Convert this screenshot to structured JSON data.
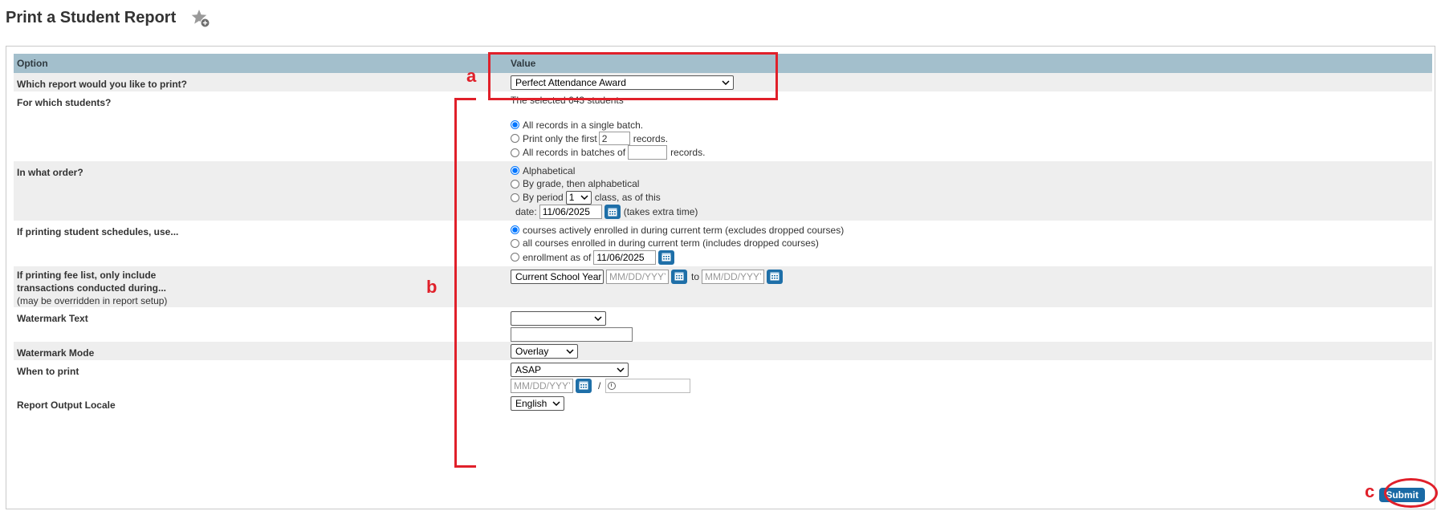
{
  "page": {
    "title": "Print a Student Report",
    "favorite_icon": "star-plus-icon"
  },
  "table": {
    "col_option": "Option",
    "col_value": "Value"
  },
  "rows": {
    "report": {
      "label": "Which report would you like to print?",
      "selected": "Perfect Attendance Award"
    },
    "students": {
      "label": "For which students?",
      "selection_text": "The selected 643 students",
      "opt_all": "All records in a single batch.",
      "opt_first_prefix": "Print only the first",
      "opt_first_value": "2",
      "opt_first_suffix": "records.",
      "opt_batches_prefix": "All records in batches of",
      "opt_batches_value": "",
      "opt_batches_suffix": "records."
    },
    "order": {
      "label": "In what order?",
      "opt_alpha": "Alphabetical",
      "opt_grade": "By grade, then alphabetical",
      "opt_period_prefix": "By period",
      "period_value": "1",
      "opt_period_suffix": "class, as of this",
      "date_label": "date:",
      "date_value": "11/06/2025",
      "extra_note": "(takes extra time)"
    },
    "schedules": {
      "label": "If printing student schedules, use...",
      "opt_active": "courses actively enrolled in during current term (excludes dropped courses)",
      "opt_all": "all courses enrolled in during current term (includes dropped courses)",
      "opt_asof": "enrollment as of",
      "asof_value": "11/06/2025"
    },
    "fees": {
      "label_line1": "If printing fee list, only include",
      "label_line2": "transactions conducted during...",
      "label_note": "(may be overridden in report setup)",
      "period_selected": "Current School Year",
      "from_placeholder": "MM/DD/YYYY",
      "to_label": "to",
      "to_placeholder": "MM/DD/YYYY"
    },
    "watermark_text": {
      "label": "Watermark Text",
      "selected": "",
      "text_value": ""
    },
    "watermark_mode": {
      "label": "Watermark Mode",
      "selected": "Overlay"
    },
    "when": {
      "label": "When to print",
      "selected": "ASAP",
      "date_placeholder": "MM/DD/YYYY",
      "separator": "/",
      "time_value": ""
    },
    "locale": {
      "label": "Report Output Locale",
      "selected": "English"
    }
  },
  "submit_label": "Submit",
  "annotations": {
    "a": "a",
    "b": "b",
    "c": "c",
    "color": "#e0202a"
  },
  "colors": {
    "header_bg": "#a3bfcc",
    "row_shade": "#eeeeee",
    "button_blue": "#1a6aa5"
  }
}
